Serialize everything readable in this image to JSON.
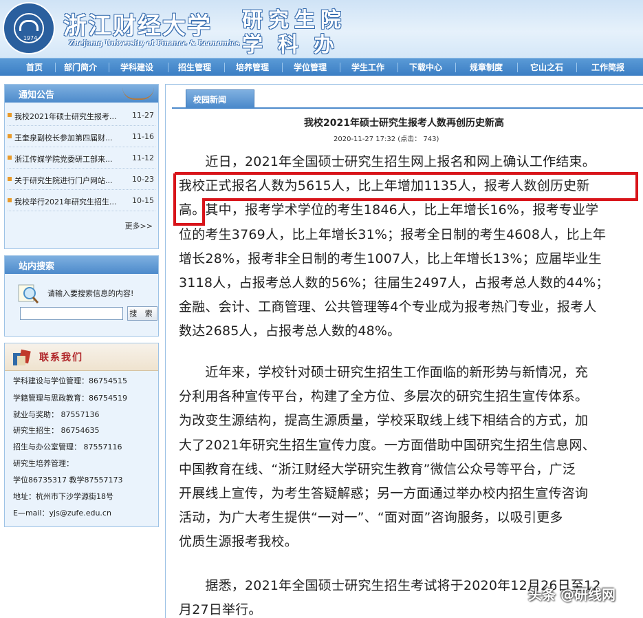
{
  "header": {
    "university_cn": "浙江财经大学",
    "university_en": "Zhejiang University of Finance & Economics",
    "logo_year": "1974",
    "dept_line1": "研究生院",
    "dept_line2": "学科办"
  },
  "nav": {
    "items": [
      "首页",
      "部门简介",
      "学科建设",
      "招生管理",
      "培养管理",
      "学位管理",
      "学生工作",
      "下载中心",
      "规章制度",
      "它山之石",
      "工作简报"
    ]
  },
  "notice": {
    "title": "通知公告",
    "items": [
      {
        "title": "我校2021年硕士研究生报考...",
        "date": "11-27"
      },
      {
        "title": "王奎泉副校长参加第四届财...",
        "date": "11-16"
      },
      {
        "title": "浙江传媒学院党委研工部来...",
        "date": "11-12"
      },
      {
        "title": "关于研究生院进行门户网站...",
        "date": "10-23"
      },
      {
        "title": "我校举行2021年研究生招生...",
        "date": "10-15"
      }
    ],
    "more": "更多>>"
  },
  "search": {
    "title": "站内搜索",
    "hint": "请输入要搜索信息的内容!",
    "button": "搜 索",
    "placeholder": ""
  },
  "contact": {
    "title": "联系我们",
    "lines": [
      "学科建设与学位管理：86754515",
      "学籍管理与思政教育：86754519",
      "就业与奖助：         87557136",
      "研究生招生：         86754635",
      "招生与办公室管理：   87557116",
      "研究生培养管理：",
      "学位86735317    教学87557173",
      "地址：杭州市下沙学源街18号",
      "E—mail：yjs@zufe.edu.cn"
    ]
  },
  "main": {
    "tab": "校园新闻",
    "title": "我校2021年硕士研究生报考人数再创历史新高",
    "meta": "2020-11-27 17:32       (点击：  743)",
    "p1_lines": [
      "　　近日，2021年全国硕士研究生招生网上报名和网上确认工作结束。",
      "我校正式报名人数为5615人，比上年增加1135人，报考人数创历史新",
      "高。其中，报考学术学位的考生1846人，比上年增长16%，报考专业学",
      "位的考生3769人，比上年增长31%；报考全日制的考生4608人，比上年",
      "增长28%，报考非全日制的考生1007人，比上年增长13%；应届毕业生",
      "3118人，占报考总人数的56%；往届生2497人，占报考总人数的44%；",
      "金融、会计、工商管理、公共管理等4个专业成为报考热门专业，报考人",
      "数达2685人，占报考总人数的48%。"
    ],
    "p2_lines": [
      "　　近年来，学校针对硕士研究生招生工作面临的新形势与新情况，充",
      "分利用各种宣传平台，构建了全方位、多层次的研究生招生宣传体系。",
      "为改变生源结构，提高生源质量，学校采取线上线下相结合的方式，加",
      "大了2021年研究生招生宣传力度。一方面借助中国研究生招生信息网、",
      "中国教育在线、“浙江财经大学研究生教育”微信公众号等平台，广泛",
      "开展线上宣传，为考生答疑解惑；另一方面通过举办校内招生宣传咨询",
      "活动，为广大考生提供“一对一”、“面对面”咨询服务，以吸引更多",
      "优质生源报考我校。"
    ],
    "p3_lines": [
      "　　据悉，2021年全国硕士研究生招生考试将于2020年12月26日至12",
      "月27日举行。"
    ]
  },
  "watermark": "头条 @研线网",
  "colors": {
    "nav_blue": "#3b7ec4",
    "highlight_red": "#d8141a",
    "contact_red": "#b0262a"
  }
}
